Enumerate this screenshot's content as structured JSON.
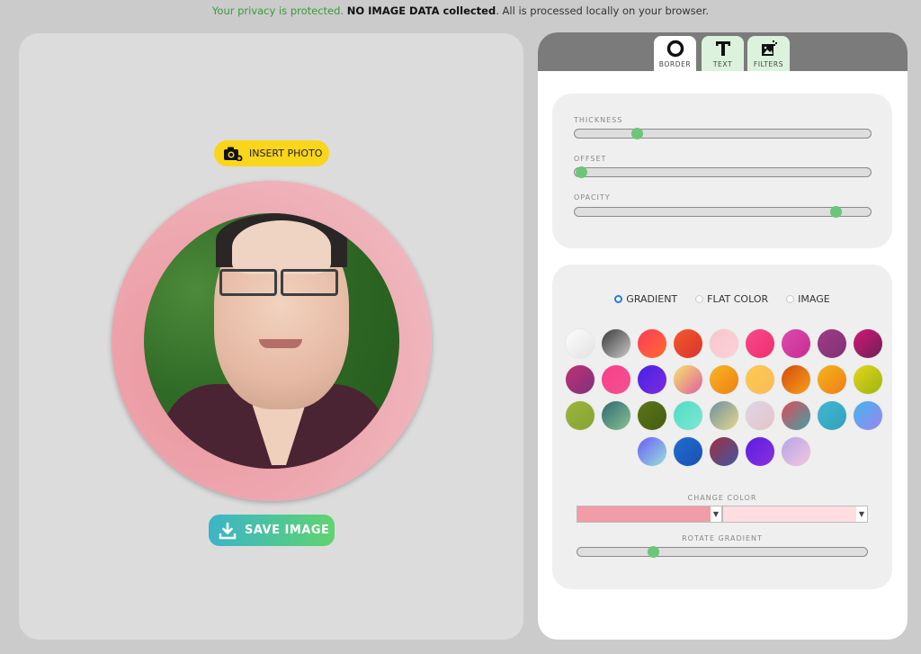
{
  "privacy": {
    "part1": "Your privacy is protected.",
    "part2": "NO IMAGE DATA collected",
    "part3": ". All is processed locally on your browser."
  },
  "editor": {
    "insert_label": "INSERT PHOTO",
    "save_label": "SAVE IMAGE"
  },
  "tabs": [
    {
      "label": "BORDER",
      "icon": "ring-icon",
      "active": true
    },
    {
      "label": "TEXT",
      "icon": "text-t-icon",
      "active": false
    },
    {
      "label": "FILTERS",
      "icon": "magic-image-icon",
      "active": false
    }
  ],
  "border": {
    "sliders": [
      {
        "label": "THICKNESS",
        "value": 0.21
      },
      {
        "label": "OFFSET",
        "value": 0.02
      },
      {
        "label": "OPACITY",
        "value": 0.88
      }
    ]
  },
  "fill": {
    "modes": [
      {
        "label": "GRADIENT",
        "checked": true
      },
      {
        "label": "FLAT COLOR",
        "checked": false
      },
      {
        "label": "IMAGE",
        "checked": false
      }
    ],
    "gradients": [
      [
        "#fdfdfd",
        "#e2e2e2"
      ],
      [
        "#3a3a3a",
        "#c9c9c9"
      ],
      [
        "#fb3b5c",
        "#ff6a2e"
      ],
      [
        "#f25a2a",
        "#d9342e"
      ],
      [
        "#f7c6ce",
        "#fbd1d8"
      ],
      [
        "#f9498a",
        "#ef2e70"
      ],
      [
        "#e048b0",
        "#c52f8f"
      ],
      [
        "#a23a84",
        "#7e3378"
      ],
      [
        "#d41872",
        "#6c1f5a"
      ],
      [
        "#c23074",
        "#7d327d"
      ],
      [
        "#fa3e8c",
        "#f2528c"
      ],
      [
        "#4a1fe9",
        "#7a2ddc"
      ],
      [
        "#f6e36a",
        "#df5fa0"
      ],
      [
        "#f7b623",
        "#f07f13"
      ],
      [
        "#fdc94f",
        "#f9bc58"
      ],
      [
        "#d34a0c",
        "#f8a11b"
      ],
      [
        "#f5b518",
        "#ef7d19"
      ],
      [
        "#e3d61b",
        "#9fb312"
      ],
      [
        "#9bb43d",
        "#86a432"
      ],
      [
        "#2d6a74",
        "#8ac28f"
      ],
      [
        "#5b7418",
        "#455d12"
      ],
      [
        "#4fdcc4",
        "#7de7d4"
      ],
      [
        "#6f8fa1",
        "#e4d88a"
      ],
      [
        "#dcd6e6",
        "#e6c3c8"
      ],
      [
        "#e24b5a",
        "#3ea1a4"
      ],
      [
        "#3fb7d4",
        "#35a1b8"
      ],
      [
        "#43b5ec",
        "#9d84f0"
      ],
      [
        "#6b5cf6",
        "#98e0dc"
      ],
      [
        "#1d6fd1",
        "#1d4fb2"
      ],
      [
        "#a0303f",
        "#3f57a3"
      ],
      [
        "#5a1fe0",
        "#8a2fe0"
      ],
      [
        "#b7a4ea",
        "#f2c6de"
      ]
    ],
    "change_color_label": "CHANGE COLOR",
    "color_from": "#f19ca6",
    "color_to": "#ffdde1",
    "rotate_label": "ROTATE GRADIENT",
    "rotate_value": 0.26
  }
}
